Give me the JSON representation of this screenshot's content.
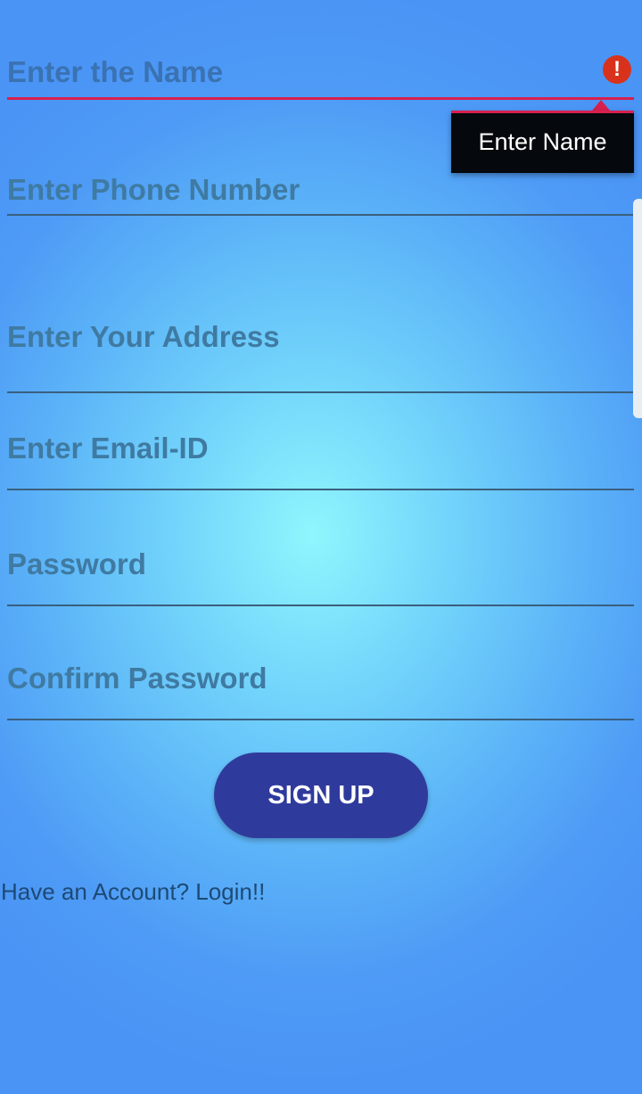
{
  "form": {
    "fields": [
      {
        "id": "name",
        "placeholder": "Enter the Name",
        "error": true
      },
      {
        "id": "phone",
        "placeholder": "Enter Phone Number",
        "error": false
      },
      {
        "id": "address",
        "placeholder": "Enter Your Address",
        "error": false
      },
      {
        "id": "email",
        "placeholder": "Enter Email-ID",
        "error": false
      },
      {
        "id": "password",
        "placeholder": "Password",
        "error": false
      },
      {
        "id": "confirm_password",
        "placeholder": "Confirm Password",
        "error": false
      }
    ],
    "error_message": "Enter Name",
    "error_icon": "exclamation-circle-icon",
    "signup_label": "SIGN UP",
    "login_link": "Have an Account? Login!!"
  },
  "colors": {
    "background_center": "#8ff6fd",
    "background_edge": "#4a94f5",
    "button": "#2f3b9c",
    "error": "#d8204f",
    "hint_text": "#3f7aa2"
  }
}
